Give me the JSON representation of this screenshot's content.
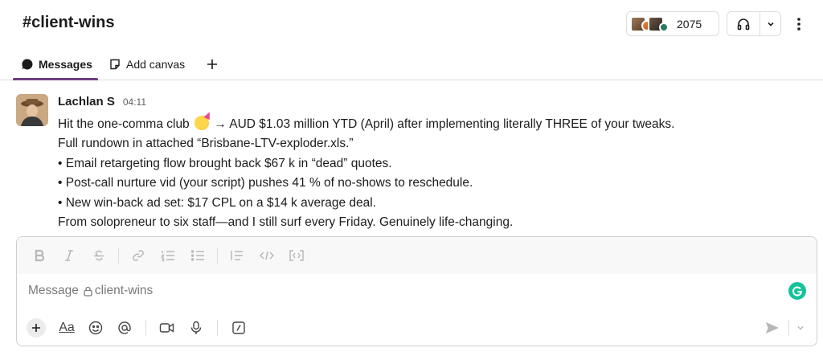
{
  "channel": {
    "title": "#client-wins"
  },
  "header": {
    "member_count": "2075",
    "icons": {
      "huddle": "headphones-icon",
      "caret": "chevron-down-icon",
      "more": "kebab-icon"
    }
  },
  "tabs": [
    {
      "label": "Messages",
      "icon": "message-bubble-icon",
      "active": true
    },
    {
      "label": "Add canvas",
      "icon": "canvas-icon"
    }
  ],
  "message": {
    "author": "Lachlan S",
    "time": "04:11",
    "line1_pre": "Hit the one-comma club",
    "line1_post": "→ AUD $1.03 million YTD (April) after implementing literally THREE of your tweaks.",
    "lines": [
      "Full rundown in attached “Brisbane-LTV-exploder.xls.”",
      "• Email retargeting flow brought back $67 k in “dead” quotes.",
      "• Post-call nurture vid (your script) pushes 41 % of no-shows to reschedule.",
      "• New win-back ad set: $17 CPL on a $14 k average deal.",
      "From solopreneur to six staff—and I still surf every Friday. Genuinely life-changing."
    ],
    "emoji": "partying-face-emoji"
  },
  "composer": {
    "placeholder_prefix": "Message",
    "placeholder_channel": "client-wins",
    "format_label": "Aa"
  },
  "colors": {
    "accent": "#6b3e80",
    "grammarly": "#15c39a",
    "border": "#dddddd"
  }
}
